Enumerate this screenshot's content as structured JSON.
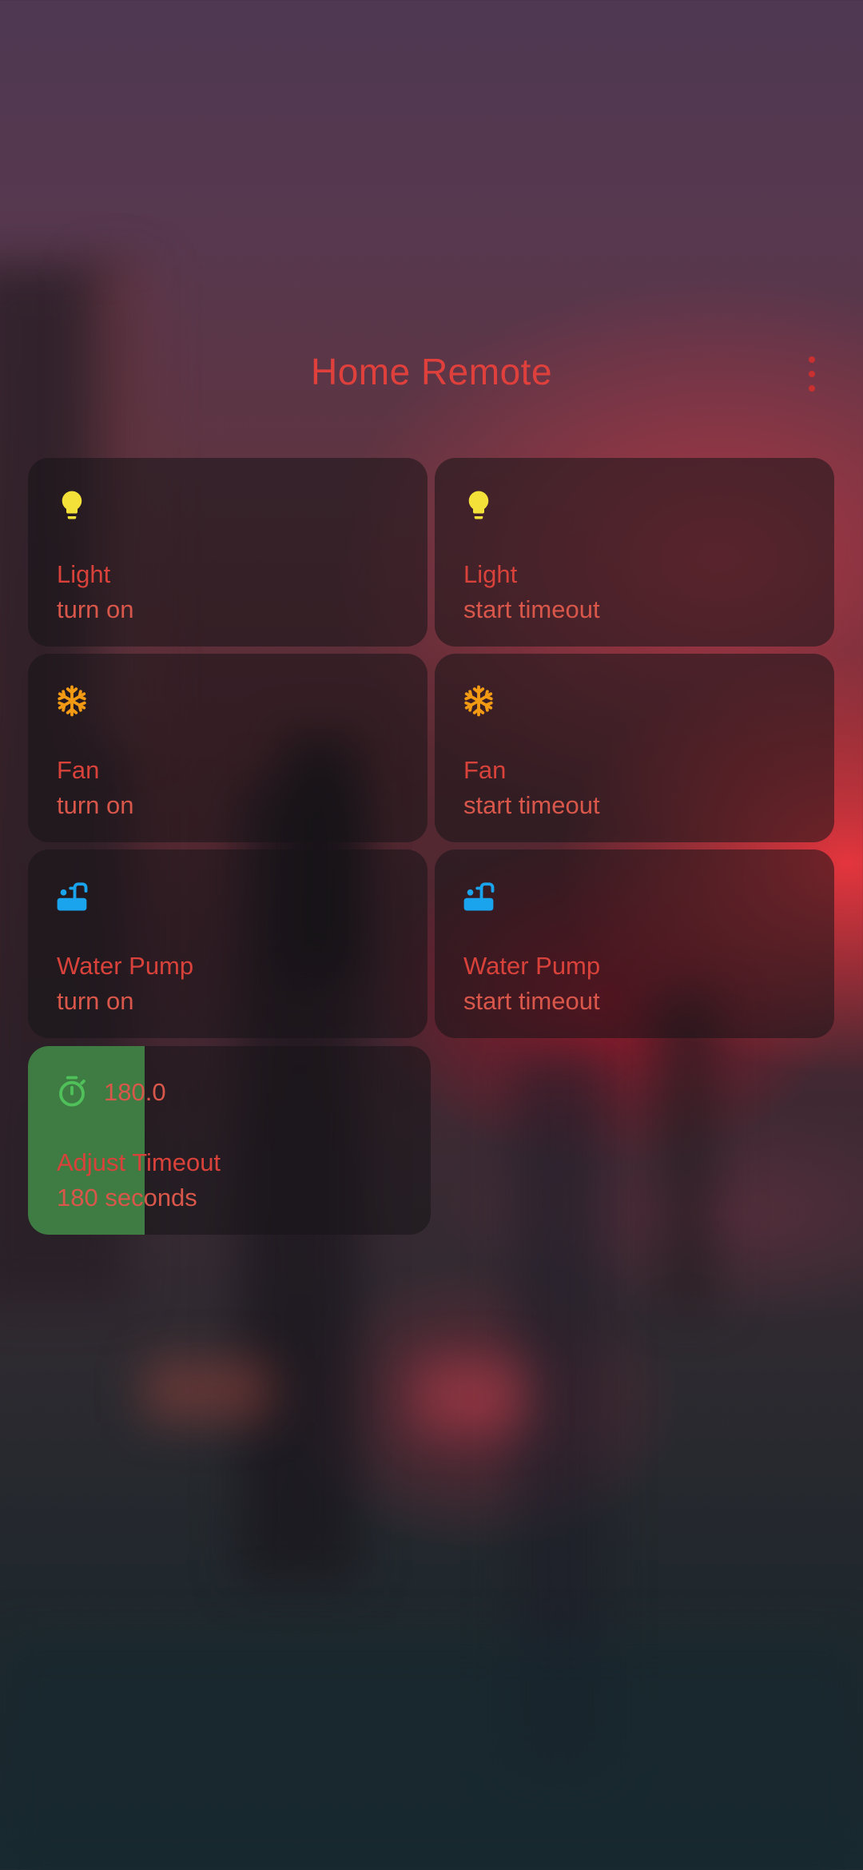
{
  "app": {
    "title": "Home Remote",
    "menu_icon": "more-vert-icon"
  },
  "colors": {
    "title": "#e0403c",
    "light_icon": "#f3e13a",
    "fan_icon": "#f29a13",
    "pump_icon": "#1aa4ee",
    "timer_icon": "#4fc05a",
    "slider_fill": "#3f7c43"
  },
  "tiles": [
    {
      "icon": "lightbulb-icon",
      "name": "Light",
      "action": "turn on"
    },
    {
      "icon": "lightbulb-icon",
      "name": "Light",
      "action": "start timeout"
    },
    {
      "icon": "snowflake-icon",
      "name": "Fan",
      "action": "turn on"
    },
    {
      "icon": "snowflake-icon",
      "name": "Fan",
      "action": "start timeout"
    },
    {
      "icon": "water-pump-icon",
      "name": "Water Pump",
      "action": "turn on"
    },
    {
      "icon": "water-pump-icon",
      "name": "Water Pump",
      "action": "start timeout"
    }
  ],
  "timeout": {
    "icon": "timer-icon",
    "value": "180.0",
    "name": "Adjust Timeout",
    "description": "180 seconds",
    "fill_fraction": 0.29
  }
}
